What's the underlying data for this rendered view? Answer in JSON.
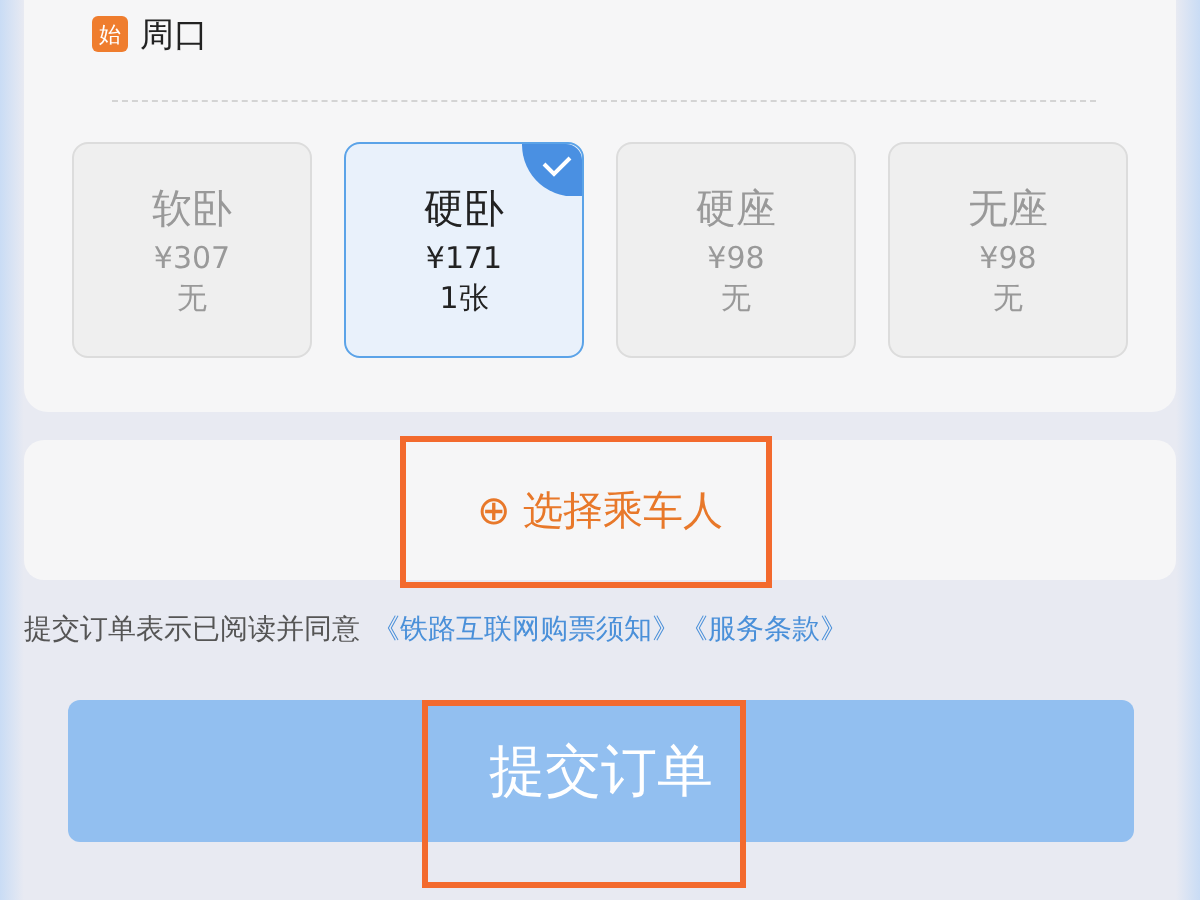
{
  "trip": {
    "origin_badge": "始",
    "origin": "周口"
  },
  "seats": [
    {
      "name": "软卧",
      "price": "¥307",
      "availability": "无",
      "selected": false,
      "disabled": true
    },
    {
      "name": "硬卧",
      "price": "¥171",
      "availability": "1张",
      "selected": true,
      "disabled": false
    },
    {
      "name": "硬座",
      "price": "¥98",
      "availability": "无",
      "selected": false,
      "disabled": true
    },
    {
      "name": "无座",
      "price": "¥98",
      "availability": "无",
      "selected": false,
      "disabled": true
    }
  ],
  "passenger": {
    "icon": "⊕",
    "label": "选择乘车人"
  },
  "agreement": {
    "text": "提交订单表示已阅读并同意",
    "links": [
      "《铁路互联网购票须知》",
      "《服务条款》"
    ]
  },
  "submit": {
    "label": "提交订单"
  }
}
